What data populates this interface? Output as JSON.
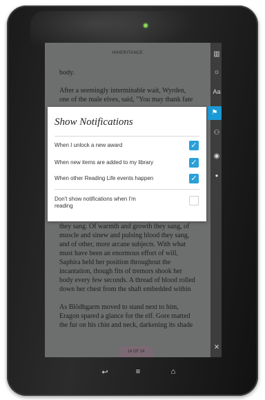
{
  "book": {
    "title": "INHERITANCE",
    "top_lines": [
      "body.",
      "",
      "After a seemingly interminable wait, Wyrden,",
      "one of the male elves, said, \"You may thank fate"
    ],
    "bottom_lines": [
      "they sang. Of warmth and growth they sang, of",
      "muscle and sinew and pulsing blood they sang,",
      "and of other, more arcane subjects. With what",
      "must have been an enormous effort of will,",
      "Saphira held her position throughout the",
      "incantation, though fits of tremors shook her",
      "body every few seconds. A thread of blood rolled",
      "down her chest from the shaft embedded within",
      "",
      "As Blödhgarm moved to stand next to him,",
      "Eragon spared a glance for the elf. Gore matted",
      "the fur on his chin and neck, darkening its shade"
    ],
    "page_indicator": "14 OF 24"
  },
  "toolbar": {
    "items": [
      {
        "name": "library-icon",
        "glyph": "▥"
      },
      {
        "name": "brightness-icon",
        "glyph": "☼"
      },
      {
        "name": "font-size-icon",
        "glyph": "Aa"
      },
      {
        "name": "flag-icon",
        "glyph": "⚑",
        "active": true
      },
      {
        "name": "friends-icon",
        "glyph": "⚇"
      },
      {
        "name": "eye-icon",
        "glyph": "◉"
      },
      {
        "name": "profile-icon",
        "glyph": "●"
      }
    ],
    "close_glyph": "×"
  },
  "dialog": {
    "title": "Show Notifications",
    "options": [
      {
        "label": "When I unlock a new award",
        "checked": true
      },
      {
        "label": "When new items are added to my library",
        "checked": true
      },
      {
        "label": "When other Reading Life events happen",
        "checked": true
      }
    ],
    "dont_show": {
      "line1": "Don't show notifications when I'm",
      "line2": "reading",
      "checked": false
    },
    "check_glyph": "✓"
  },
  "nav": {
    "back_glyph": "↩",
    "menu_glyph": "≡",
    "home_glyph": "⌂"
  },
  "colors": {
    "accent": "#1b9ad6",
    "checkbox": "#2aa0d8",
    "page": "#6d6e6e"
  }
}
